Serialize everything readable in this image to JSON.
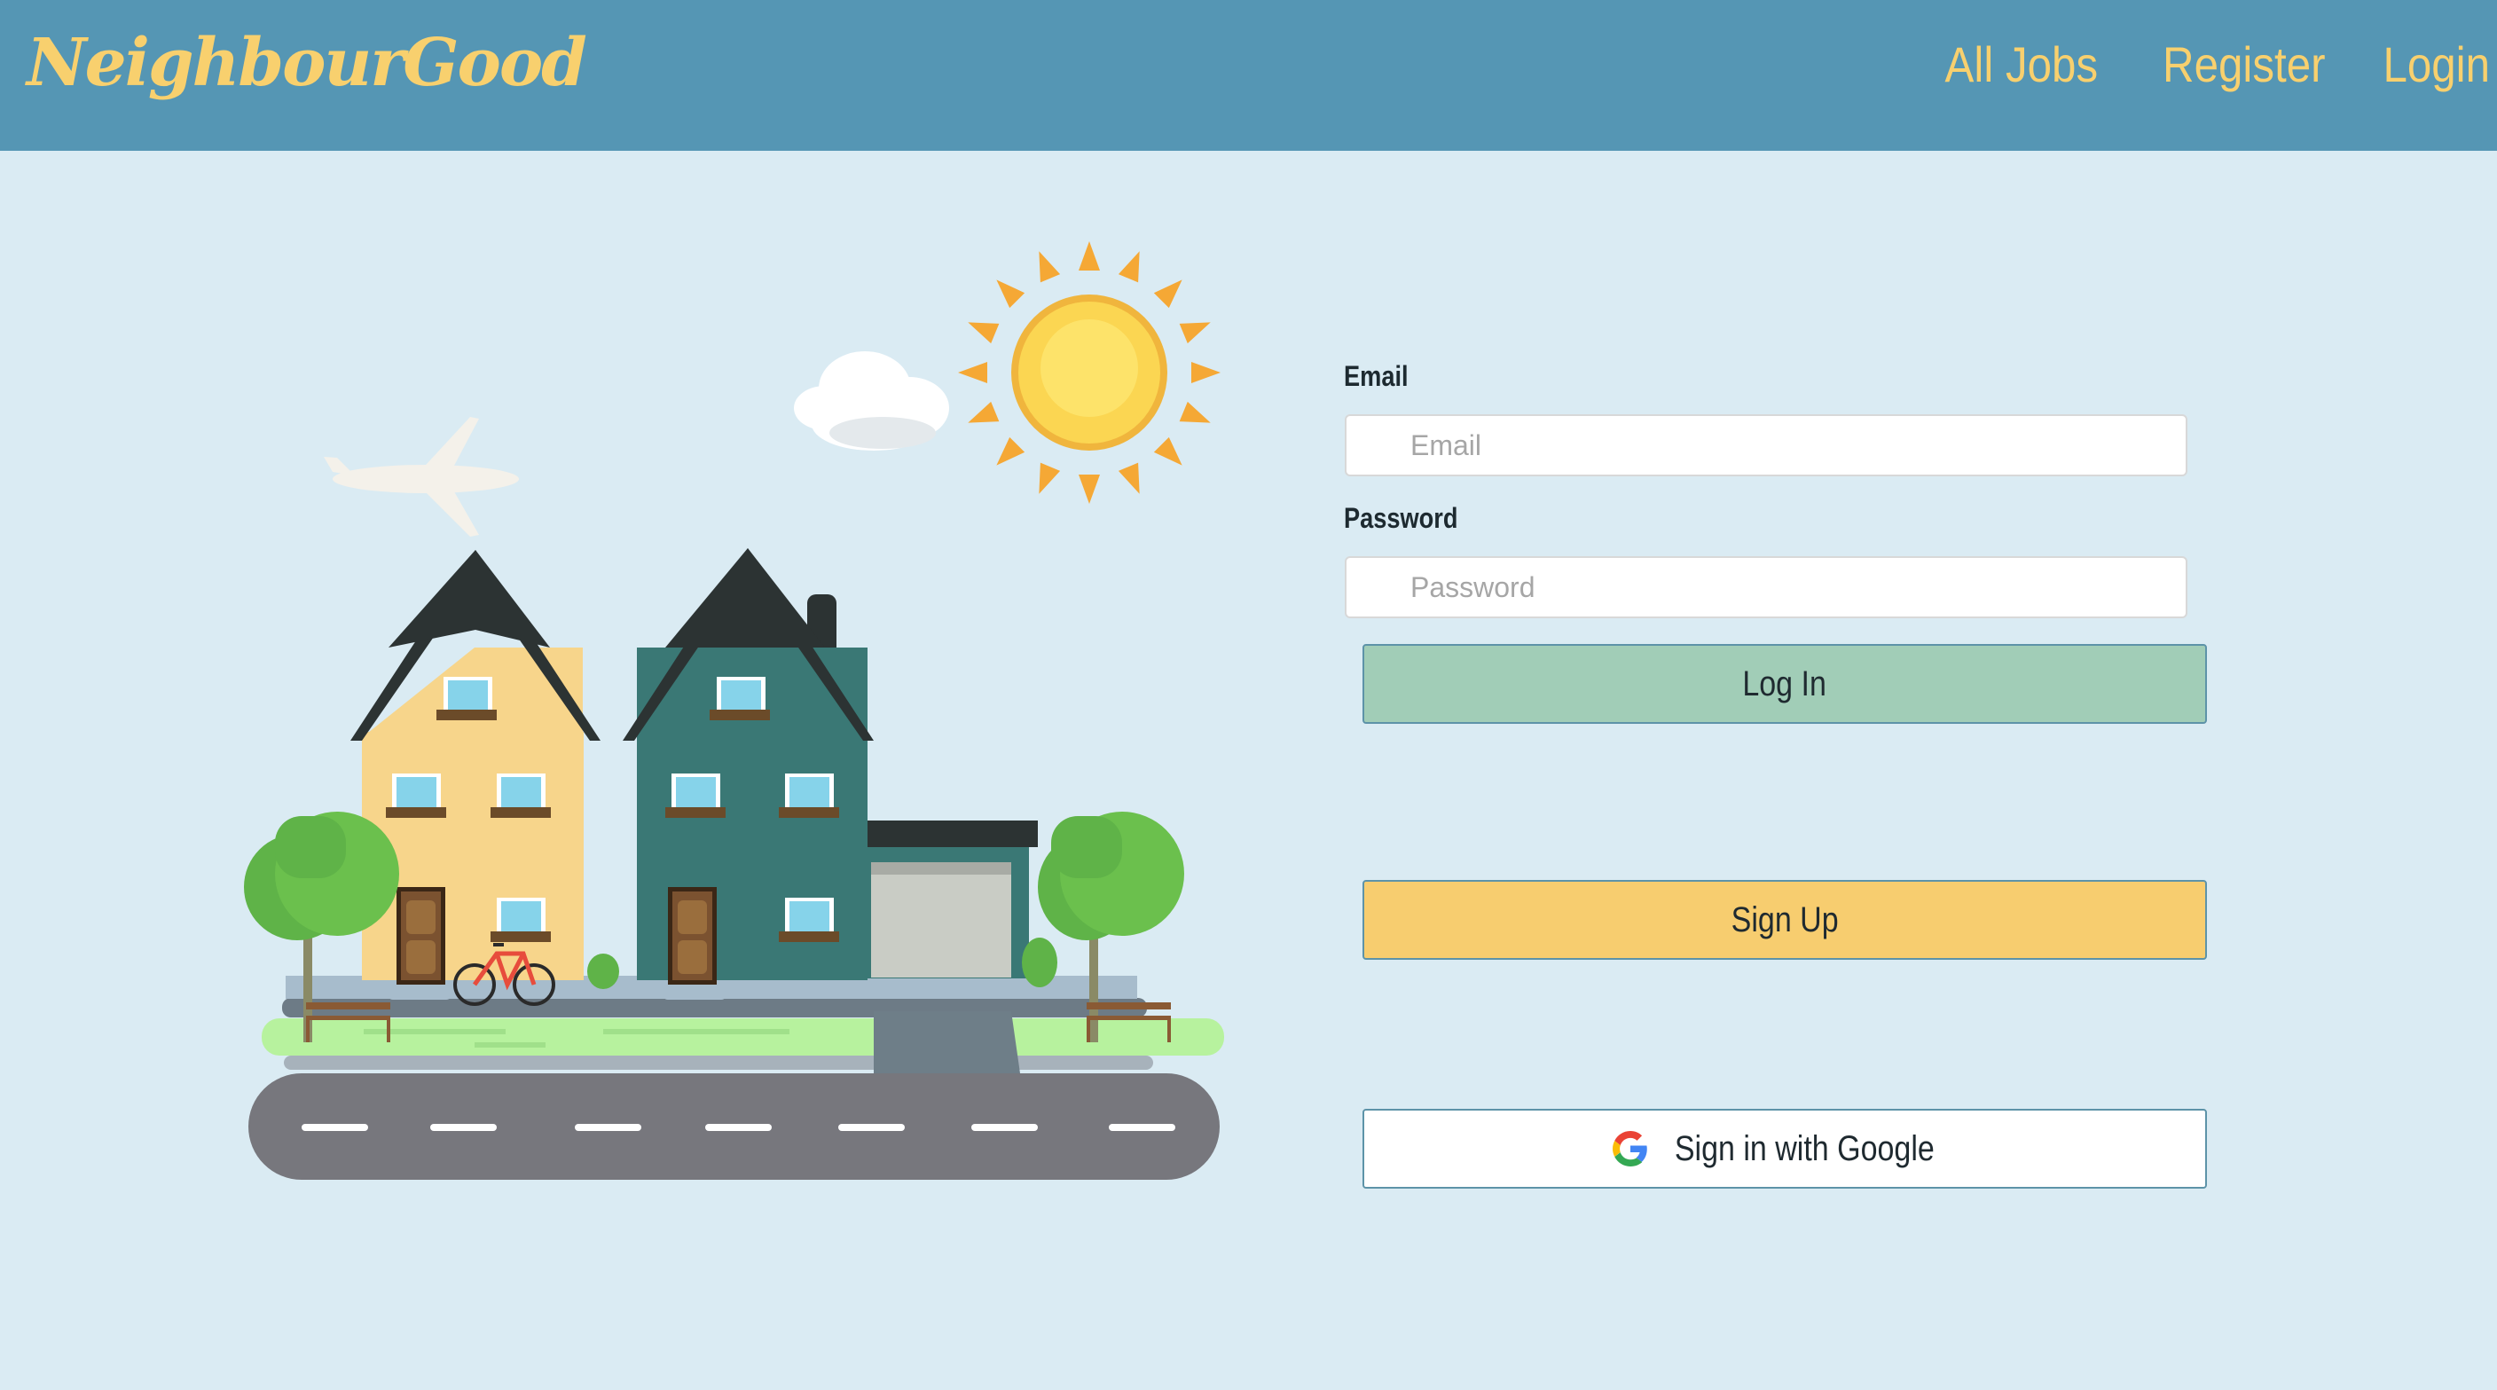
{
  "nav": {
    "brand": "NeighbourGood",
    "links": [
      "All Jobs",
      "Register",
      "Login"
    ]
  },
  "form": {
    "email_label": "Email",
    "email_placeholder": "Email",
    "password_label": "Password",
    "password_placeholder": "Password",
    "login_button": "Log In",
    "signup_button": "Sign Up",
    "google_button": "Sign in with Google"
  },
  "icons": {
    "illustration": "town-illustration",
    "google": "google-g-icon"
  },
  "colors": {
    "navbar": "#5596b4",
    "accent_text": "#f8d06e",
    "background": "#daebf3",
    "login_button": "#a1cdb7",
    "signup_button": "#f7cd6f"
  }
}
